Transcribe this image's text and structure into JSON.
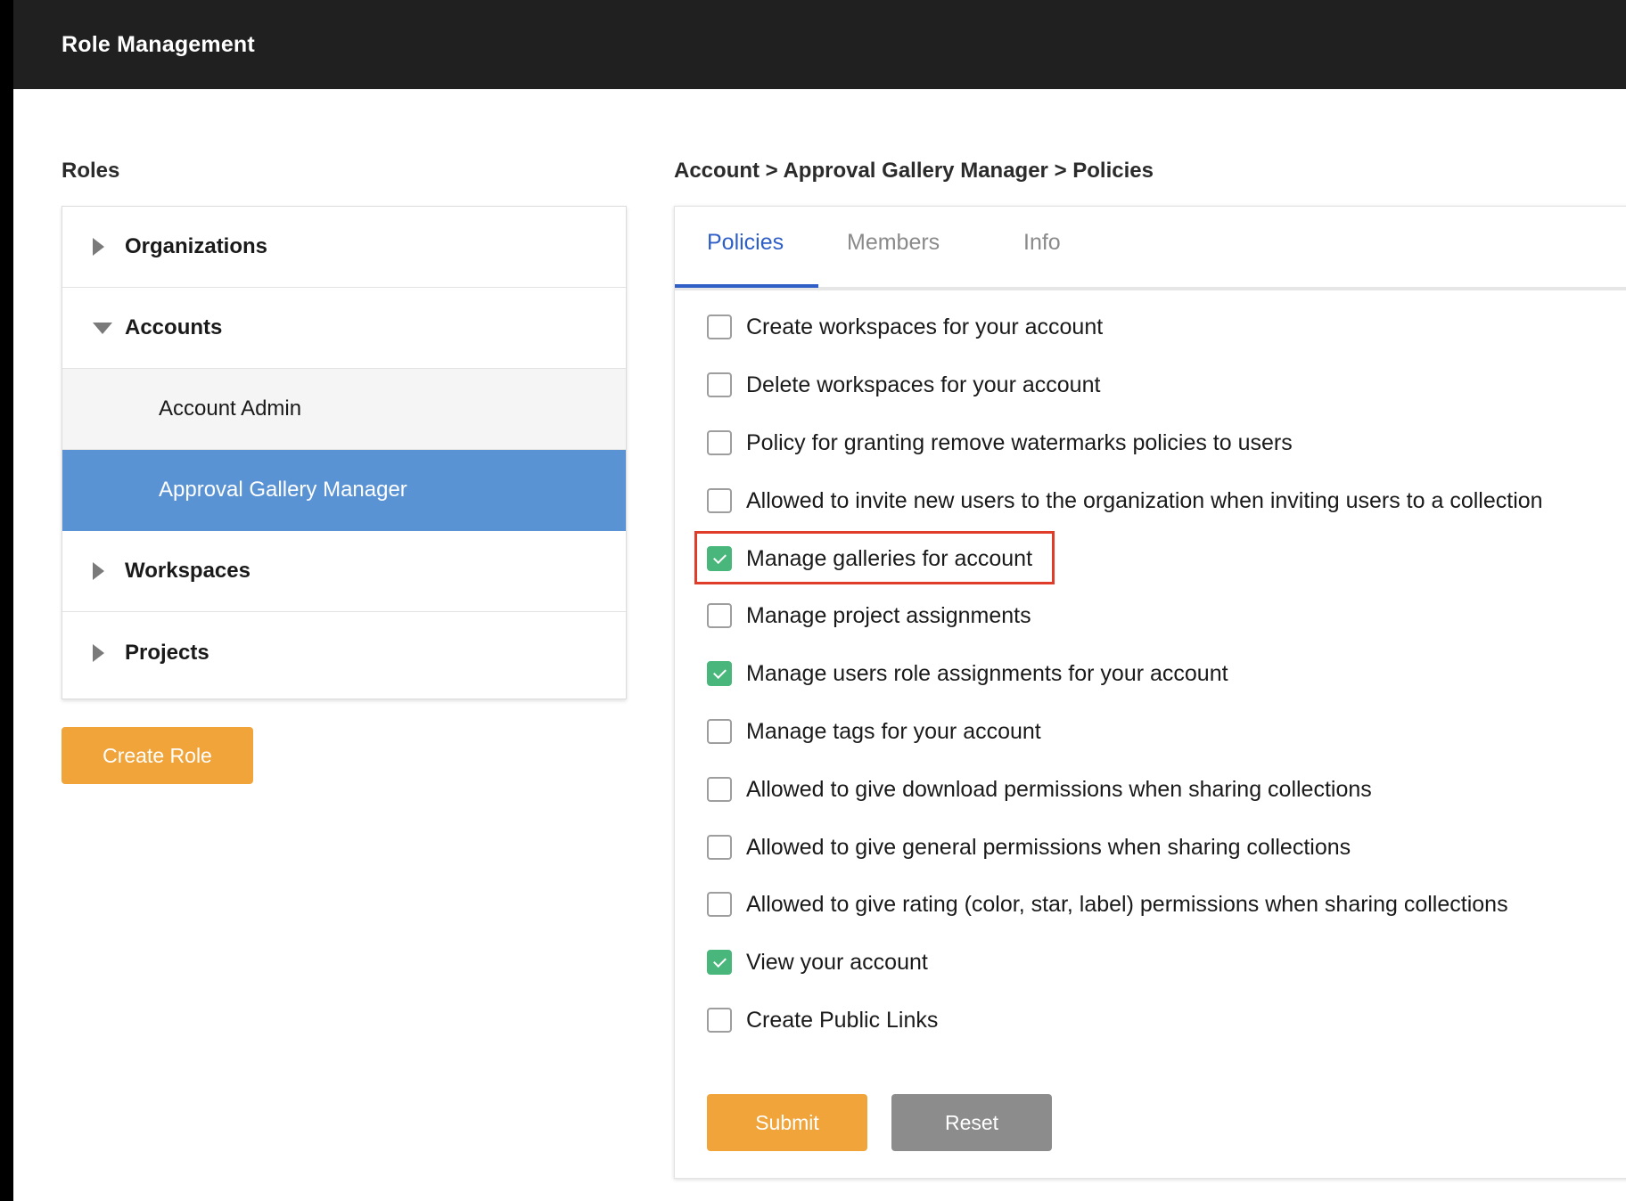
{
  "header": {
    "title": "Role Management"
  },
  "roles": {
    "heading": "Roles",
    "items": [
      {
        "label": "Organizations",
        "type": "group",
        "expanded": false
      },
      {
        "label": "Accounts",
        "type": "group",
        "expanded": true
      },
      {
        "label": "Account Admin",
        "type": "child",
        "selected": false
      },
      {
        "label": "Approval Gallery Manager",
        "type": "child",
        "selected": true
      },
      {
        "label": "Workspaces",
        "type": "group",
        "expanded": false
      },
      {
        "label": "Projects",
        "type": "group",
        "expanded": false
      }
    ],
    "create_button": "Create Role"
  },
  "breadcrumb": "Account > Approval Gallery Manager > Policies",
  "tabs": [
    {
      "label": "Policies",
      "active": true
    },
    {
      "label": "Members",
      "active": false
    },
    {
      "label": "Info",
      "active": false
    }
  ],
  "policies": [
    {
      "label": "Create workspaces for your account",
      "checked": false
    },
    {
      "label": "Delete workspaces for your account",
      "checked": false
    },
    {
      "label": "Policy for granting remove watermarks policies to users",
      "checked": false
    },
    {
      "label": "Allowed to invite new users to the organization when inviting users to a collection",
      "checked": false
    },
    {
      "label": "Manage galleries for account",
      "checked": true,
      "highlighted": true
    },
    {
      "label": "Manage project assignments",
      "checked": false
    },
    {
      "label": "Manage users role assignments for your account",
      "checked": true
    },
    {
      "label": "Manage tags for your account",
      "checked": false
    },
    {
      "label": "Allowed to give download permissions when sharing collections",
      "checked": false
    },
    {
      "label": "Allowed to give general permissions when sharing collections",
      "checked": false
    },
    {
      "label": "Allowed to give rating (color, star, label) permissions when sharing collections",
      "checked": false
    },
    {
      "label": "View your account",
      "checked": true
    },
    {
      "label": "Create Public Links",
      "checked": false
    }
  ],
  "actions": {
    "submit": "Submit",
    "reset": "Reset"
  },
  "colors": {
    "accent_orange": "#f0a43a",
    "selected_blue": "#5a93d4",
    "tab_blue": "#2f5fc6",
    "check_green": "#49b77b",
    "highlight_red": "#e03c2a"
  }
}
